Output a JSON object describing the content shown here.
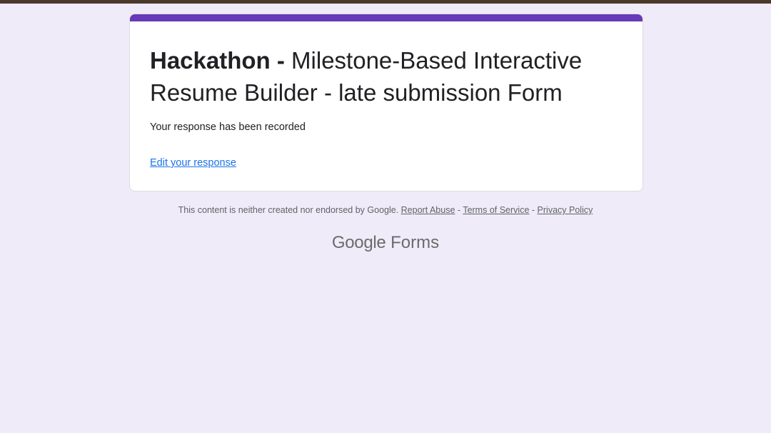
{
  "form": {
    "title_bold": "Hackathon -",
    "title_rest": "Milestone-Based Interactive Resume Builder - late submission Form",
    "confirmation": "Your response has been recorded",
    "edit_link": "Edit your response"
  },
  "footer": {
    "disclaimer": "This content is neither created nor endorsed by Google.",
    "report_abuse": "Report Abuse",
    "separator": "-",
    "terms": "Terms of Service",
    "privacy": "Privacy Policy"
  },
  "logo": {
    "google": "Google",
    "forms": "Forms"
  },
  "colors": {
    "background": "#f0ebf8",
    "accent": "#673ab7",
    "link": "#1a73e8"
  }
}
